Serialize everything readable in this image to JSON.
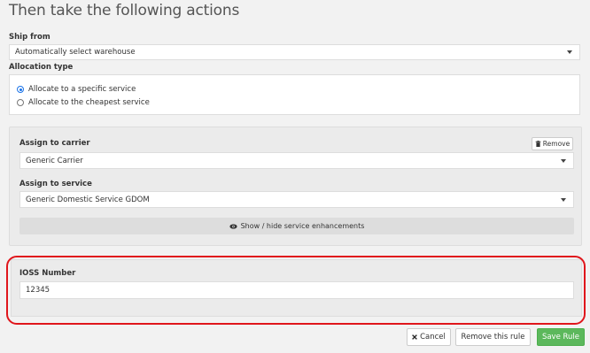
{
  "heading": "Then take the following actions",
  "ship_from": {
    "label": "Ship from",
    "value": "Automatically select warehouse"
  },
  "allocation": {
    "label": "Allocation type",
    "options": [
      {
        "label": "Allocate to a specific service",
        "checked": true
      },
      {
        "label": "Allocate to the cheapest service",
        "checked": false
      }
    ]
  },
  "carrier": {
    "label": "Assign to carrier",
    "value": "Generic Carrier",
    "remove_label": "Remove"
  },
  "service": {
    "label": "Assign to service",
    "value": "Generic Domestic Service GDOM"
  },
  "enhancements": {
    "label": "Show / hide service enhancements"
  },
  "ioss": {
    "label": "IOSS Number",
    "value": "12345"
  },
  "actions": {
    "cancel": "Cancel",
    "remove_rule": "Remove this rule",
    "save": "Save Rule"
  },
  "colors": {
    "highlight": "#e0161c",
    "save": "#5cb85c",
    "radio": "#1a73e8"
  },
  "icons": {
    "remove": "trash-icon",
    "enhancements": "eye-icon",
    "cancel": "close-icon"
  }
}
